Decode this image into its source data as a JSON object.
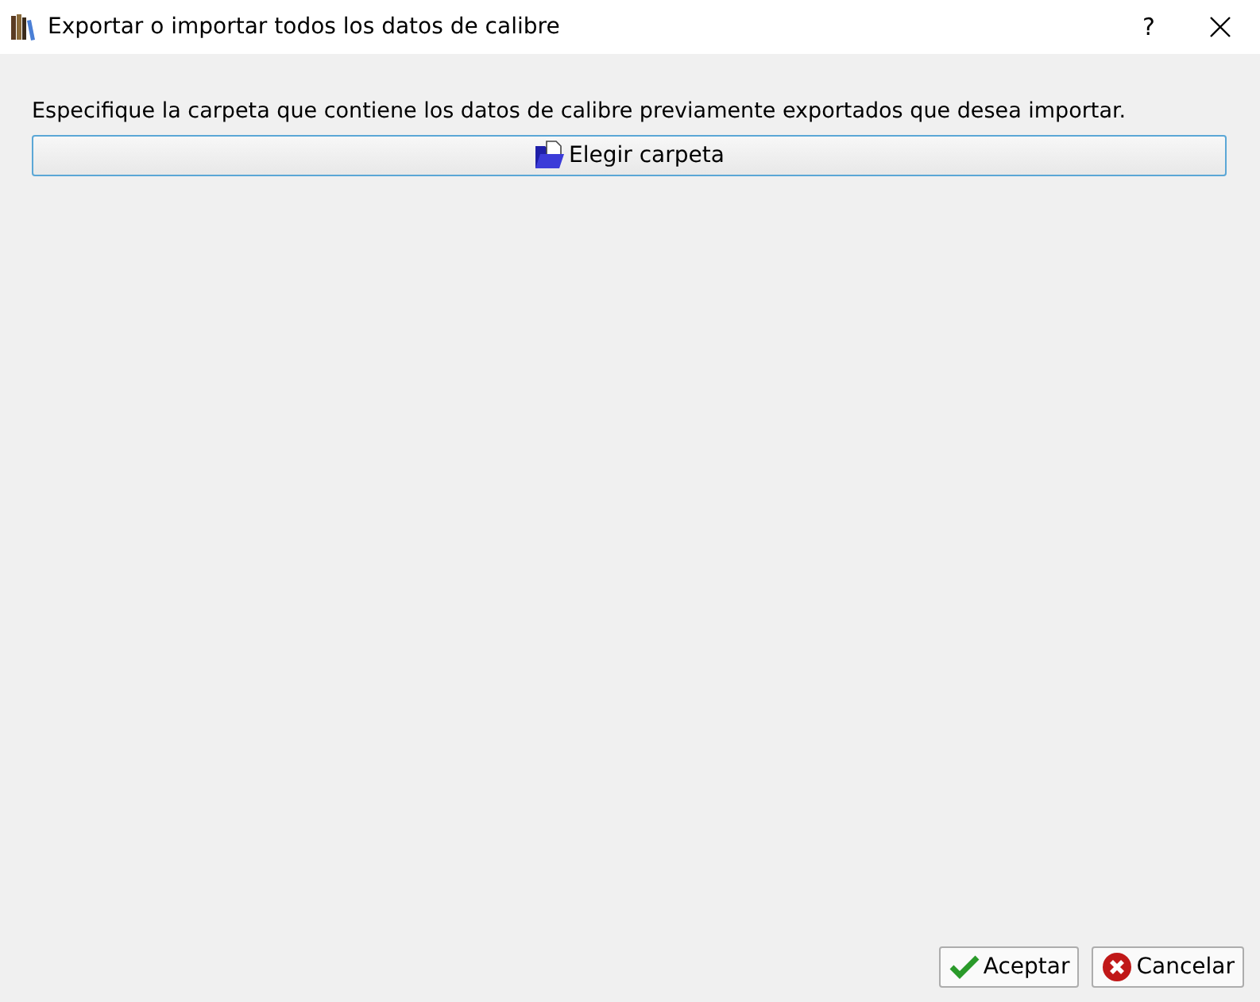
{
  "window": {
    "title": "Exportar o importar todos los datos de calibre",
    "help": "?"
  },
  "instruction": "Especifique la carpeta que contiene los datos de calibre previamente exportados que desea importar.",
  "choose_button": {
    "label": "Elegir carpeta"
  },
  "buttons": [
    {
      "label": "Aceptar",
      "kind": "ok"
    },
    {
      "label": "Cancelar",
      "kind": "cancel"
    }
  ]
}
